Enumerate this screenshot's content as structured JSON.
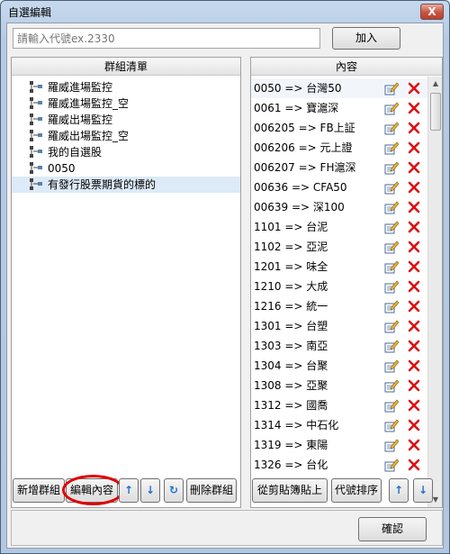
{
  "window": {
    "title": "自選編輯",
    "close_glyph": "X"
  },
  "search": {
    "placeholder": "請輸入代號ex.2330"
  },
  "add_button": "加入",
  "groups_panel": {
    "header": "群組清單",
    "items": [
      {
        "label": "羅威進場監控"
      },
      {
        "label": "羅威進場監控_空"
      },
      {
        "label": "羅威出場監控"
      },
      {
        "label": "羅威出場監控_空"
      },
      {
        "label": "我的自選股"
      },
      {
        "label": "0050"
      },
      {
        "label": "有發行股票期貨的標的",
        "selected": true
      }
    ]
  },
  "content_panel": {
    "header": "內容",
    "items": [
      "0050 => 台灣50",
      "0061 => 寶滬深",
      "006205 => FB上証",
      "006206 => 元上證",
      "006207 => FH滬深",
      "00636 => CFA50",
      "00639 => 深100",
      "1101 => 台泥",
      "1102 => 亞泥",
      "1201 => 味全",
      "1210 => 大成",
      "1216 => 統一",
      "1301 => 台塑",
      "1303 => 南亞",
      "1304 => 台聚",
      "1308 => 亞聚",
      "1312 => 國喬",
      "1314 => 中石化",
      "1319 => 東陽",
      "1326 => 台化"
    ]
  },
  "left_buttons": {
    "new_group": "新增群組",
    "edit_content": "編輯內容",
    "move_up": "↑",
    "move_down": "↓",
    "refresh": "↻",
    "delete_group": "刪除群組"
  },
  "right_buttons": {
    "paste_clipboard": "從剪貼簿貼上",
    "sort_code": "代號排序",
    "move_up": "↑",
    "move_down": "↓"
  },
  "ok_button": "確認",
  "colors": {
    "accent_arrow": "#1f6fd1",
    "delete_red": "#e01010",
    "highlight_circle": "#e00000"
  },
  "icons": {
    "tree": "tree-node-icon",
    "edit": "edit-icon",
    "delete": "delete-icon"
  }
}
